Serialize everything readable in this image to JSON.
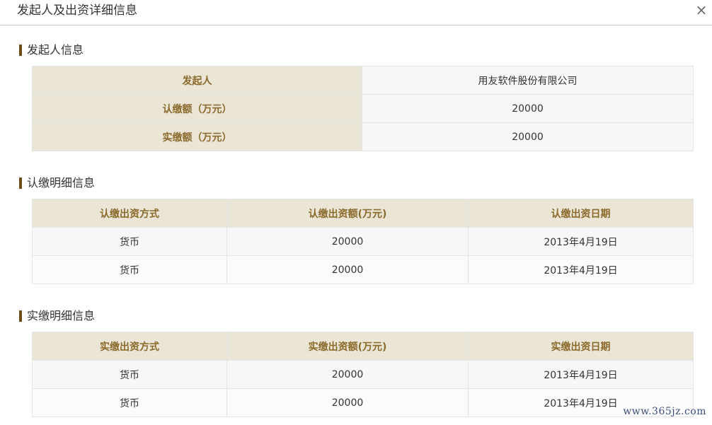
{
  "dialog": {
    "title": "发起人及出资详细信息",
    "close_icon": "×"
  },
  "founder_section": {
    "title": "发起人信息",
    "rows": [
      {
        "label": "发起人",
        "value": "用友软件股份有限公司"
      },
      {
        "label": "认缴额（万元）",
        "value": "20000"
      },
      {
        "label": "实缴额（万元）",
        "value": "20000"
      }
    ]
  },
  "subscribed_section": {
    "title": "认缴明细信息",
    "headers": [
      "认缴出资方式",
      "认缴出资额(万元)",
      "认缴出资日期"
    ],
    "rows": [
      [
        "货币",
        "20000",
        "2013年4月19日"
      ],
      [
        "货币",
        "20000",
        "2013年4月19日"
      ]
    ]
  },
  "paid_section": {
    "title": "实缴明细信息",
    "headers": [
      "实缴出资方式",
      "实缴出资额(万元)",
      "实缴出资日期"
    ],
    "rows": [
      [
        "货币",
        "20000",
        "2013年4月19日"
      ],
      [
        "货币",
        "20000",
        "2013年4月19日"
      ]
    ]
  },
  "watermark": "www.365jz.com"
}
